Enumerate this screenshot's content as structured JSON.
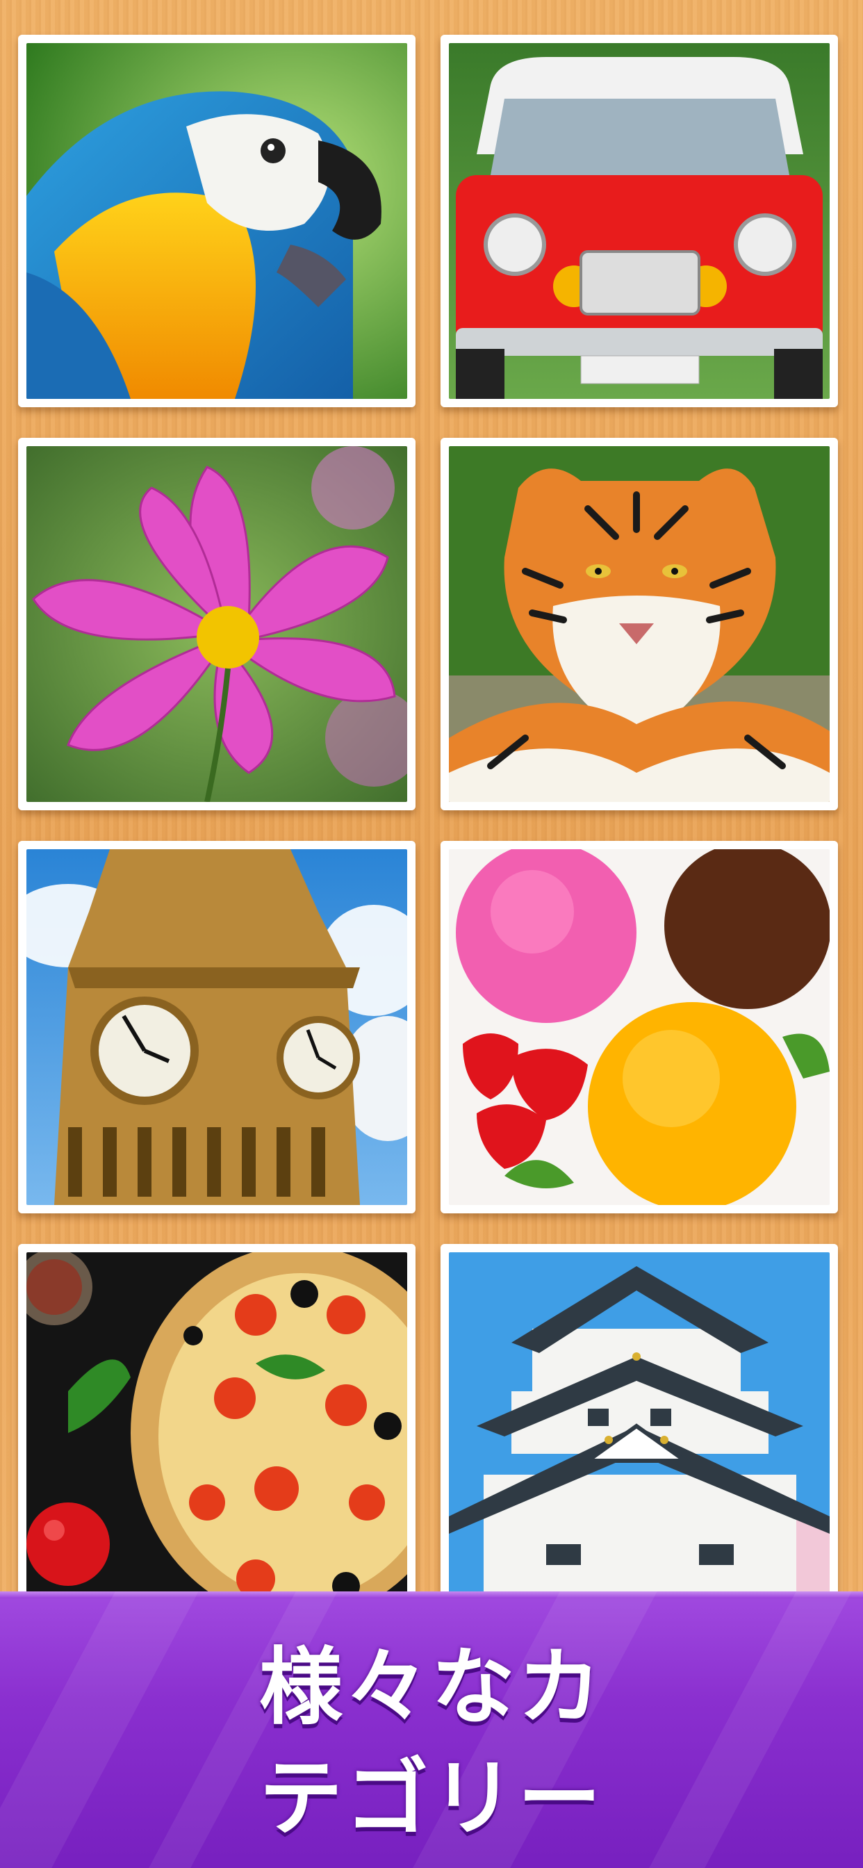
{
  "gallery": {
    "tiles": [
      {
        "icon": "parrot-icon",
        "subject": "parrot"
      },
      {
        "icon": "car-icon",
        "subject": "car"
      },
      {
        "icon": "flower-icon",
        "subject": "flower"
      },
      {
        "icon": "tiger-icon",
        "subject": "tiger"
      },
      {
        "icon": "clock-tower-icon",
        "subject": "clock-tower"
      },
      {
        "icon": "ice-cream-icon",
        "subject": "ice-cream"
      },
      {
        "icon": "pizza-icon",
        "subject": "pizza"
      },
      {
        "icon": "castle-icon",
        "subject": "castle"
      }
    ]
  },
  "banner": {
    "line1": "様々なカ",
    "line2": "テゴリー",
    "color": "#8a2fcf"
  }
}
